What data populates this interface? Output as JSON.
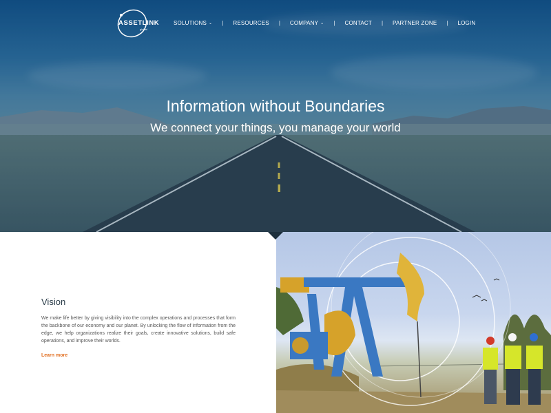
{
  "nav": {
    "logo_text": "ASSETLINK",
    "logo_sub": "global",
    "items": [
      {
        "label": "SOLUTIONS",
        "dropdown": true
      },
      {
        "label": "RESOURCES",
        "dropdown": false
      },
      {
        "label": "COMPANY",
        "dropdown": true
      },
      {
        "label": "CONTACT",
        "dropdown": false
      },
      {
        "label": "PARTNER ZONE",
        "dropdown": false
      },
      {
        "label": "LOGIN",
        "dropdown": false
      }
    ],
    "separator": "|",
    "chevron": "⌄"
  },
  "hero": {
    "title": "Information without Boundaries",
    "subtitle": "We connect your things, you manage your world"
  },
  "vision": {
    "heading": "Vision",
    "body": "We make life better by giving visibility into the complex operations and processes that form the backbone of our economy and our planet. By unlocking the flow of information from the edge, we help organizations realize their goals, create innovative solutions, build safe operations, and improve their worlds.",
    "link": "Learn more"
  },
  "colors": {
    "accent": "#e06a1a",
    "heading": "#2c3e4a"
  }
}
